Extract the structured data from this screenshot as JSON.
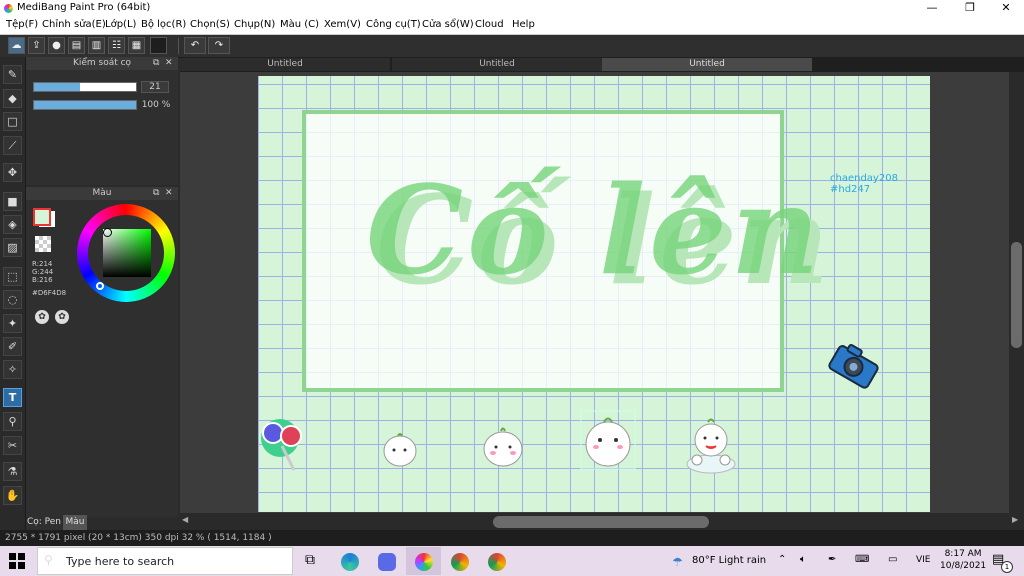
{
  "window": {
    "title": "MediBang Paint Pro (64bit)",
    "min": "—",
    "restore": "❐",
    "close": "✕"
  },
  "menu": [
    "Tệp(F)",
    "Chỉnh sửa(E)",
    "Lớp(L)",
    "Bộ lọc(R)",
    "Chọn(S)",
    "Chụp(N)",
    "Màu (C)",
    "Xem(V)",
    "Công cụ(T)",
    "Cửa sổ(W)",
    "Cloud",
    "Help"
  ],
  "brush_panel": {
    "title": "Kiểm soát cọ",
    "size_value": "21",
    "opacity_value": "100 %",
    "size_fraction": 0.45,
    "opacity_fraction": 1.0
  },
  "color_panel": {
    "title": "Màu",
    "r": "R:214",
    "g": "G:244",
    "b": "B:216",
    "hex": "#D6F4D8",
    "current_color": "#d6f4d8"
  },
  "doc_tabs": [
    "Untitled",
    "Untitled",
    "Untitled"
  ],
  "canvas": {
    "title_text": "Cố lên",
    "watermark_line1": "chaenday208",
    "watermark_line2": "#hd247",
    "bg_color": "#d6f4d8",
    "frame_color": "#8fd490",
    "text_color": "#78d47d"
  },
  "bottom_tabs": {
    "pen": "Cọ: Pen",
    "color": "Màu"
  },
  "status": "2755 * 1791 pixel    (20 * 13cm)    350 dpi    32 %    ( 1514, 1184 )",
  "taskbar": {
    "search_placeholder": "Type here to search",
    "weather": "80°F  Light rain",
    "lang": "VIE",
    "time": "8:17 AM",
    "date": "10/8/2021",
    "notif_count": "1"
  }
}
